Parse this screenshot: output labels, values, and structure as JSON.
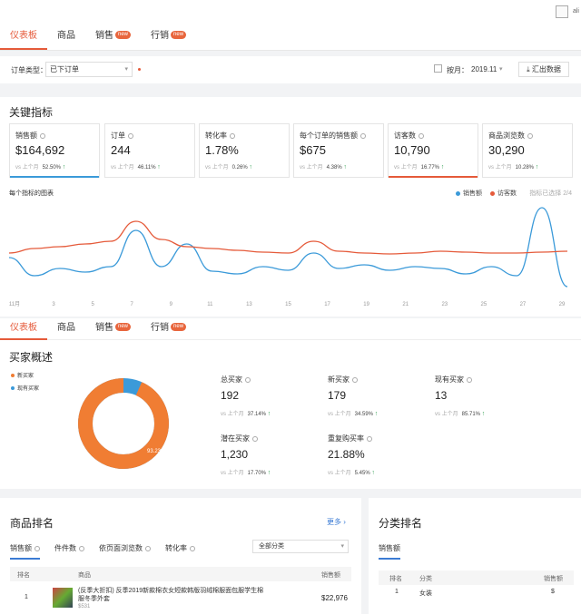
{
  "topnav": {
    "tabs": [
      {
        "label": "仪表板",
        "active": true,
        "badge": ""
      },
      {
        "label": "商品",
        "active": false,
        "badge": ""
      },
      {
        "label": "销售",
        "active": false,
        "badge": "new"
      },
      {
        "label": "行销",
        "active": false,
        "badge": "new"
      }
    ],
    "avatar_text": "ali"
  },
  "filters": {
    "order_type_label": "订单类型：",
    "order_type_value": "已下订单",
    "period_label": "按月：",
    "period_value": "2019.11",
    "export_label": "汇出数据"
  },
  "kpi": {
    "section_title": "关键指标",
    "cards": [
      {
        "label": "销售额",
        "value": "$164,692",
        "compare": "vs 上个月",
        "pct": "52.50%",
        "trend": "up",
        "highlight": "#3b9ad9"
      },
      {
        "label": "订单",
        "value": "244",
        "compare": "vs 上个月",
        "pct": "46.11%",
        "trend": "up",
        "highlight": ""
      },
      {
        "label": "转化率",
        "value": "1.78%",
        "compare": "vs 上个月",
        "pct": "0.26%",
        "trend": "up",
        "highlight": ""
      },
      {
        "label": "每个订单的销售额",
        "value": "$675",
        "compare": "vs 上个月",
        "pct": "4.38%",
        "trend": "up",
        "highlight": ""
      },
      {
        "label": "访客数",
        "value": "10,790",
        "compare": "vs 上个月",
        "pct": "16.77%",
        "trend": "up",
        "highlight": "#e55a3a"
      },
      {
        "label": "商品浏览数",
        "value": "30,290",
        "compare": "vs 上个月",
        "pct": "10.28%",
        "trend": "up",
        "highlight": ""
      }
    ],
    "chart_title": "每个指标的图表",
    "legend_hint": "指标已选择 2/4"
  },
  "chart_data": {
    "type": "line",
    "title": "每个指标的图表",
    "x": [
      "11月",
      "3",
      "5",
      "7",
      "9",
      "11",
      "13",
      "15",
      "17",
      "19",
      "21",
      "23",
      "25",
      "27",
      "29"
    ],
    "series": [
      {
        "name": "销售额",
        "color": "#3b9ad9",
        "values": [
          40,
          20,
          28,
          24,
          30,
          70,
          30,
          55,
          25,
          22,
          30,
          26,
          45,
          28,
          32,
          26,
          30,
          28,
          22,
          30,
          20,
          95,
          8
        ]
      },
      {
        "name": "访客数",
        "color": "#e55a3a",
        "values": [
          45,
          50,
          52,
          55,
          58,
          80,
          60,
          52,
          50,
          48,
          46,
          45,
          58,
          47,
          45,
          44,
          45,
          47,
          46,
          45,
          45,
          46,
          47
        ]
      }
    ],
    "ylim": [
      0,
      100
    ],
    "grid": false,
    "legend": "top-right"
  },
  "buyer": {
    "tabs": [
      {
        "label": "仪表板",
        "active": true,
        "badge": ""
      },
      {
        "label": "商品",
        "active": false,
        "badge": ""
      },
      {
        "label": "销售",
        "active": false,
        "badge": "new"
      },
      {
        "label": "行销",
        "active": false,
        "badge": "new"
      }
    ],
    "section_title": "买家概述",
    "legend_new": "新买家",
    "legend_existing": "现有买家",
    "donut_label": "93.23%",
    "donut_new_pct": 93.23,
    "color_new": "#f07d33",
    "color_existing": "#3b9ad9",
    "metrics": [
      {
        "label": "总买家",
        "value": "192",
        "compare": "vs 上个月",
        "pct": "37.14%"
      },
      {
        "label": "新买家",
        "value": "179",
        "compare": "vs 上个月",
        "pct": "34.59%"
      },
      {
        "label": "现有买家",
        "value": "13",
        "compare": "vs 上个月",
        "pct": "85.71%"
      },
      {
        "label": "潜在买家",
        "value": "1,230",
        "compare": "vs 上个月",
        "pct": "17.70%"
      },
      {
        "label": "重复购买率",
        "value": "21.88%",
        "compare": "vs 上个月",
        "pct": "5.45%"
      }
    ]
  },
  "ranking": {
    "section_title": "商品排名",
    "more_label": "更多",
    "subtabs": [
      "销售额",
      "件件数",
      "依页面浏览数",
      "转化率"
    ],
    "category_select": "全部分类",
    "headers": {
      "rank": "排名",
      "product": "商品",
      "sales": "销售额"
    },
    "rows": [
      {
        "rank": "1",
        "name": "(反季大折扣) 反季2019新款棉衣女短款韩版羽绒棉服面包服学生棉服冬季外套",
        "price": "$531",
        "sales": "$22,976"
      }
    ]
  },
  "category": {
    "section_title": "分类排名",
    "subtab": "销售额",
    "headers": {
      "rank": "排名",
      "category": "分类",
      "sales": "销售额"
    },
    "rows": [
      {
        "rank": "1",
        "category": "女装",
        "sales": "$"
      }
    ]
  }
}
